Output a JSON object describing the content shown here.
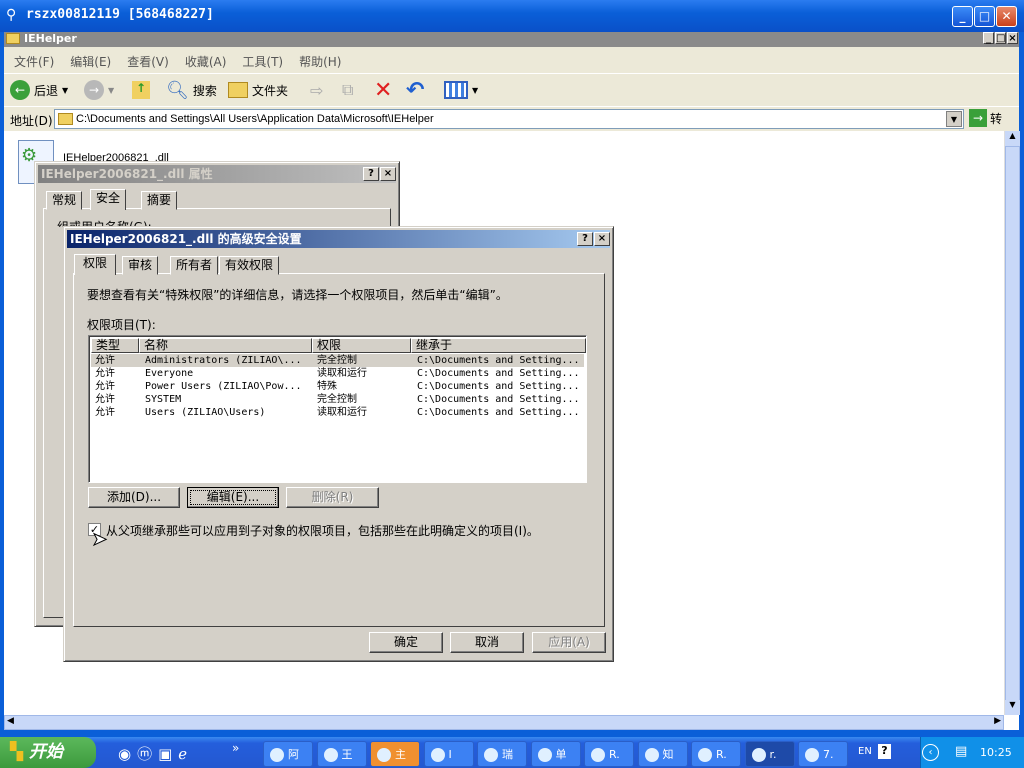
{
  "outer_window": {
    "title": "rszx00812119 [568468227]"
  },
  "explorer": {
    "title": "IEHelper",
    "menu": [
      "文件(F)",
      "编辑(E)",
      "查看(V)",
      "收藏(A)",
      "工具(T)",
      "帮助(H)"
    ],
    "toolbar": {
      "back": "后退",
      "search": "搜索",
      "folders": "文件夹"
    },
    "address_label": "地址(D)",
    "address_value": "C:\\Documents and Settings\\All Users\\Application Data\\Microsoft\\IEHelper",
    "go_label": "转",
    "file_name": "IEHelper2006821_.dll"
  },
  "properties_dialog": {
    "title": "IEHelper2006821_.dll 属性",
    "tabs": [
      "常规",
      "安全",
      "摘要"
    ],
    "active_tab": "安全",
    "partial_label": "组或用户名称(G):"
  },
  "advanced_dialog": {
    "title": "IEHelper2006821_.dll 的高级安全设置",
    "tabs": [
      "权限",
      "审核",
      "所有者",
      "有效权限"
    ],
    "active_tab": "权限",
    "info_text": "要想查看有关“特殊权限”的详细信息，请选择一个权限项目，然后单击“编辑”。",
    "list_label": "权限项目(T):",
    "columns": [
      "类型",
      "名称",
      "权限",
      "继承于"
    ],
    "rows": [
      {
        "type": "允许",
        "name": "Administrators (ZILIAO\\...",
        "perm": "完全控制",
        "inherit": "C:\\Documents and Setting...",
        "selected": true
      },
      {
        "type": "允许",
        "name": "Everyone",
        "perm": "读取和运行",
        "inherit": "C:\\Documents and Setting..."
      },
      {
        "type": "允许",
        "name": "Power Users (ZILIAO\\Pow...",
        "perm": "特殊",
        "inherit": "C:\\Documents and Setting..."
      },
      {
        "type": "允许",
        "name": "SYSTEM",
        "perm": "完全控制",
        "inherit": "C:\\Documents and Setting..."
      },
      {
        "type": "允许",
        "name": "Users (ZILIAO\\Users)",
        "perm": "读取和运行",
        "inherit": "C:\\Documents and Setting..."
      }
    ],
    "buttons": {
      "add": "添加(D)...",
      "edit": "编辑(E)...",
      "remove": "删除(R)"
    },
    "inherit_checkbox": {
      "label": "从父项继承那些可以应用到子对象的权限项目，包括那些在此明确定义的项目(I)。",
      "checked": true
    },
    "footer": {
      "ok": "确定",
      "cancel": "取消",
      "apply": "应用(A)"
    }
  },
  "taskbar": {
    "start": "开始",
    "tasks": [
      "阿",
      "王",
      "主",
      "I",
      "瑞",
      "单",
      "R.",
      "知",
      "R.",
      "r.",
      "7."
    ],
    "active_task": "r.",
    "lang": "EN",
    "clock": "10:25"
  },
  "colors": {
    "xp_blue": "#0a5fd8",
    "dialog_gray": "#d4d0c8",
    "active_title": "#0a246a",
    "start_green": "#3c9a3c"
  }
}
